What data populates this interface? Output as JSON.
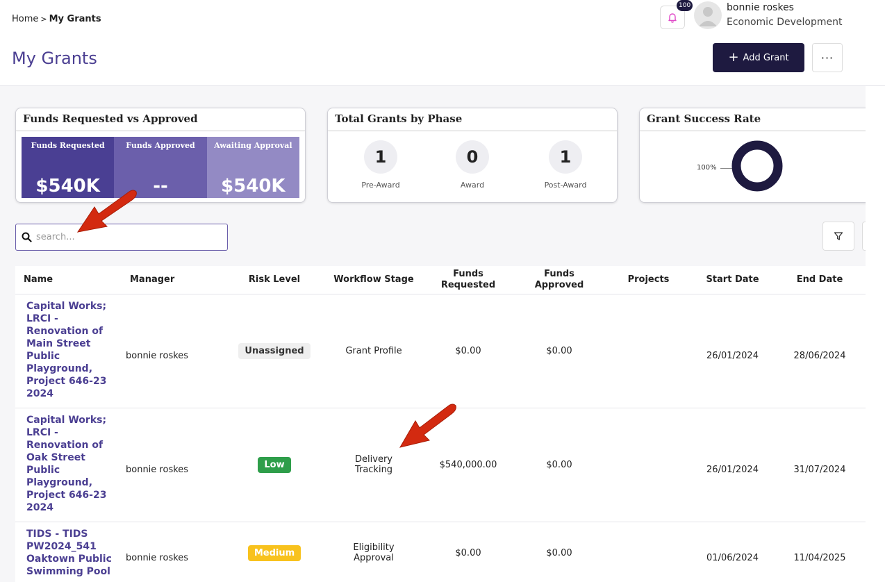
{
  "breadcrumb": {
    "home": "Home",
    "separator": ">",
    "current": "My Grants"
  },
  "page_title": "My Grants",
  "notifications": {
    "count": "100",
    "icon": "bell-icon"
  },
  "user": {
    "name": "bonnie roskes",
    "department": "Economic Development"
  },
  "actions": {
    "add_grant": "Add Grant",
    "more": "···"
  },
  "cards": {
    "funds": {
      "title": "Funds Requested vs Approved",
      "tiles": [
        {
          "label": "Funds Requested",
          "value": "$540K",
          "color": "#4a3f93"
        },
        {
          "label": "Funds Approved",
          "value": "--",
          "color": "#6b5fab"
        },
        {
          "label": "Awaiting Approval",
          "value": "$540K",
          "color": "#938ac4"
        }
      ]
    },
    "phase": {
      "title": "Total Grants by Phase",
      "items": [
        {
          "count": "1",
          "label": "Pre-Award"
        },
        {
          "count": "0",
          "label": "Award"
        },
        {
          "count": "1",
          "label": "Post-Award"
        }
      ]
    },
    "success": {
      "title": "Grant Success Rate",
      "rate_label": "100%",
      "rate_value": 100,
      "color": "#1e1a40"
    }
  },
  "search": {
    "placeholder": "search..."
  },
  "table": {
    "headers": {
      "name": "Name",
      "manager": "Manager",
      "risk": "Risk Level",
      "stage": "Workflow Stage",
      "requested_1": "Funds",
      "requested_2": "Requested",
      "approved_1": "Funds",
      "approved_2": "Approved",
      "projects": "Projects",
      "start": "Start Date",
      "end": "End Date"
    },
    "rows": [
      {
        "name": "Capital Works; LRCI - Renovation of Main Street Public Playground, Project 646-23 2024",
        "manager": "bonnie roskes",
        "risk": "Unassigned",
        "stage_1": "Grant Profile",
        "stage_2": "",
        "requested": "$0.00",
        "approved": "$0.00",
        "projects": "",
        "start": "26/01/2024",
        "end": "28/06/2024"
      },
      {
        "name": "Capital Works; LRCI - Renovation of Oak Street Public Playground, Project 646-23 2024",
        "manager": "bonnie roskes",
        "risk": "Low",
        "stage_1": "Delivery",
        "stage_2": "Tracking",
        "requested": "$540,000.00",
        "approved": "$0.00",
        "projects": "",
        "start": "26/01/2024",
        "end": "31/07/2024"
      },
      {
        "name": "TIDS - TIDS PW2024_541 Oaktown Public Swimming Pool",
        "manager": "bonnie roskes",
        "risk": "Medium",
        "stage_1": "Eligibility",
        "stage_2": "Approval",
        "requested": "$0.00",
        "approved": "$0.00",
        "projects": "",
        "start": "01/06/2024",
        "end": "11/04/2025"
      }
    ]
  },
  "colors": {
    "accent": "#4b3f92",
    "primary_button": "#1e1a40",
    "annotation_arrow": "#d32a10"
  }
}
